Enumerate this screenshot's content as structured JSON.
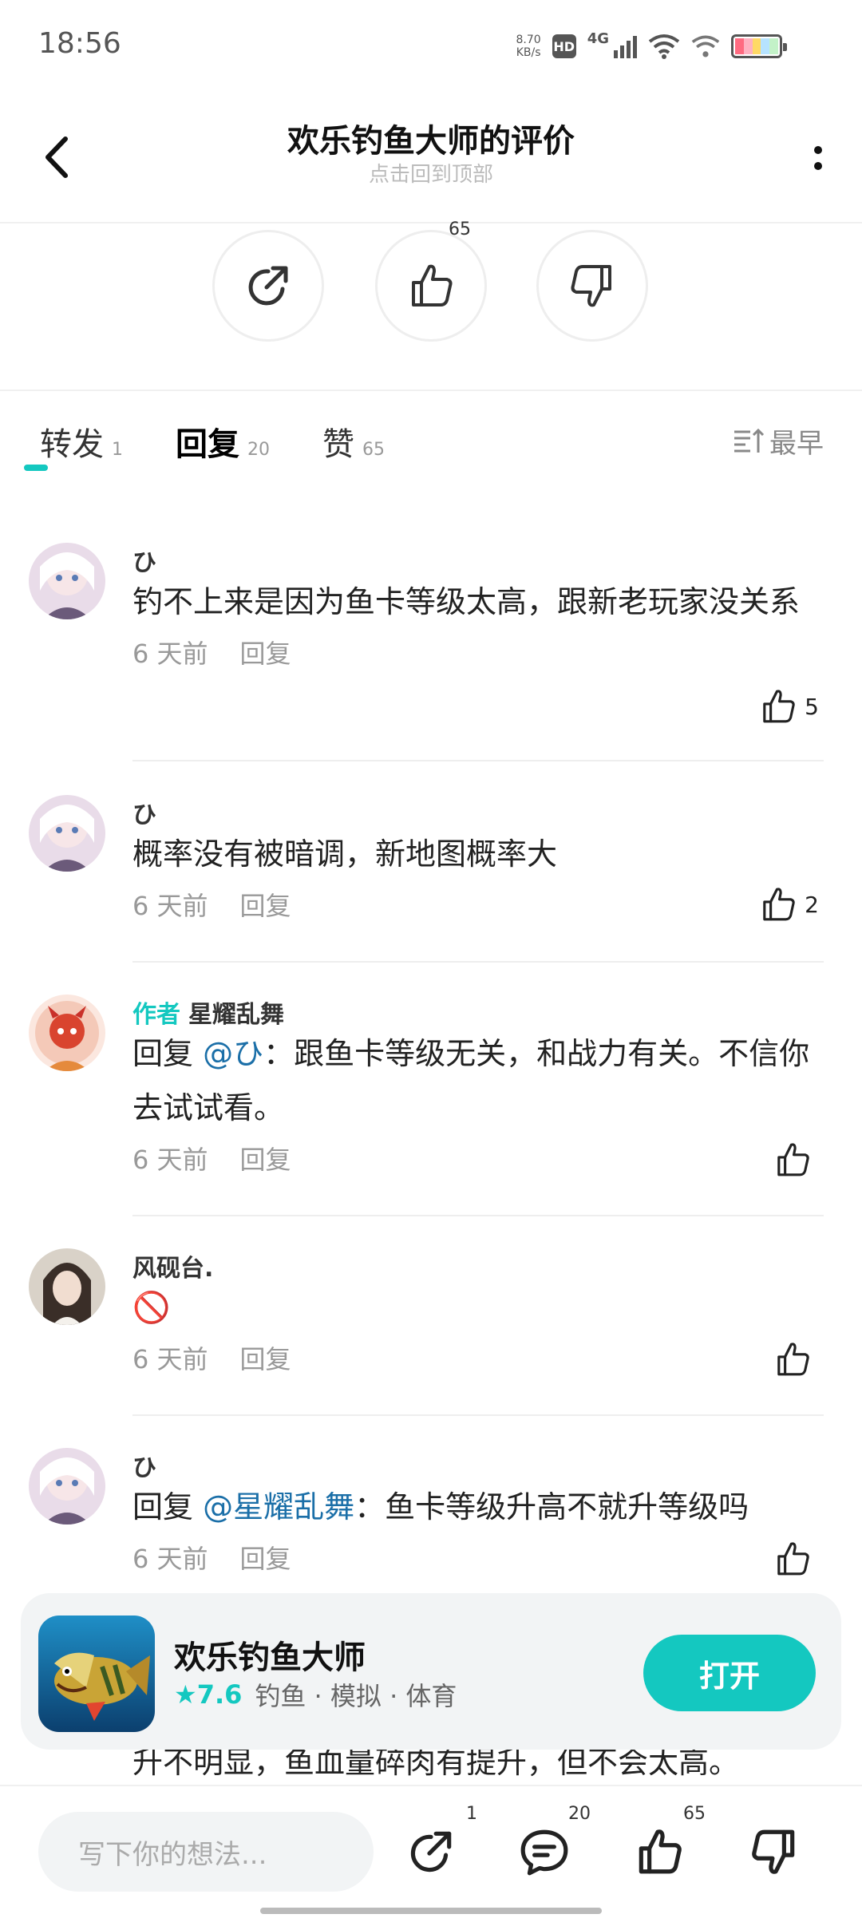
{
  "status_bar": {
    "time": "18:56",
    "speed_value": "8.70",
    "speed_unit": "KB/s",
    "hd": "HD",
    "network": "4G"
  },
  "header": {
    "title": "欢乐钓鱼大师的评价",
    "subtitle": "点击回到顶部"
  },
  "actions": {
    "like_count": "65"
  },
  "tabs": [
    {
      "label": "转发",
      "count": "1"
    },
    {
      "label": "回复",
      "count": "20"
    },
    {
      "label": "赞",
      "count": "65"
    }
  ],
  "sort_label": "最早",
  "comments": [
    {
      "user": "ひ",
      "text": "钓不上来是因为鱼卡等级太高，跟新老玩家没关系",
      "time": "6 天前",
      "reply": "回复",
      "likes": "5"
    },
    {
      "user": "ひ",
      "text": "概率没有被暗调，新地图概率大",
      "time": "6 天前",
      "reply": "回复",
      "likes": "2"
    },
    {
      "author_tag": "作者",
      "user": "星耀乱舞",
      "reply_prefix": "回复",
      "mention": "@ひ",
      "text": "：跟鱼卡等级无关，和战力有关。不信你去试试看。",
      "time": "6 天前",
      "reply": "回复",
      "likes": ""
    },
    {
      "user": "风砚台.",
      "text": "🚫",
      "time": "6 天前",
      "reply": "回复",
      "likes": ""
    },
    {
      "user": "ひ",
      "reply_prefix": "回复",
      "mention": "@星耀乱舞",
      "text": "：鱼卡等级升高不就升等级吗",
      "time": "6 天前",
      "reply": "回复",
      "likes": ""
    }
  ],
  "app_card": {
    "name": "欢乐钓鱼大师",
    "rating": "7.6",
    "tags": "钓鱼 · 模拟 · 体育",
    "open_label": "打开"
  },
  "peek_text": "升不明显，鱼血量碎肉有提升，但不会太高。",
  "bottom_bar": {
    "placeholder": "写下你的想法...",
    "share_count": "1",
    "comment_count": "20",
    "like_count": "65"
  },
  "colors": {
    "accent": "#14c8c0",
    "mention": "#1b6fa8"
  }
}
